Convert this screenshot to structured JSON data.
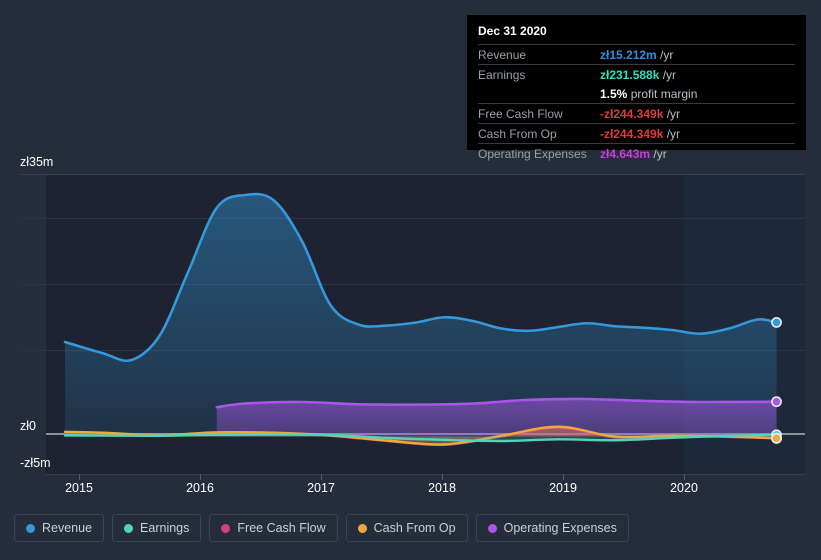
{
  "chart_data": {
    "type": "area",
    "title": "",
    "xlabel": "",
    "ylabel": "",
    "currency_symbol": "zł",
    "grid": true,
    "legend_position": "bottom",
    "ylim": [
      -5,
      35
    ],
    "y_ticks": [
      {
        "value": 35,
        "label": "zł35m"
      },
      {
        "value": 0,
        "label": "zł0"
      },
      {
        "value": -5,
        "label": "-zł5m"
      }
    ],
    "x_ticks": [
      "2015",
      "2016",
      "2017",
      "2018",
      "2019",
      "2020"
    ],
    "x_range": [
      "2014-07",
      "2021-03"
    ],
    "series": [
      {
        "name": "Revenue",
        "color": "#3498db",
        "x": [
          "2014-09",
          "2015-01",
          "2015-04",
          "2015-07",
          "2015-10",
          "2016-01",
          "2016-04",
          "2016-07",
          "2016-10",
          "2017-01",
          "2017-04",
          "2017-07",
          "2017-10",
          "2018-01",
          "2018-04",
          "2018-07",
          "2018-10",
          "2019-01",
          "2019-04",
          "2019-07",
          "2019-10",
          "2020-01",
          "2020-04",
          "2020-07",
          "2020-10",
          "2020-12"
        ],
        "values": [
          12.6,
          11.1,
          10.2,
          13.5,
          22.0,
          30.5,
          32.2,
          31.5,
          26.0,
          17.5,
          14.9,
          14.8,
          15.2,
          15.9,
          15.4,
          14.4,
          14.1,
          14.6,
          15.1,
          14.7,
          14.5,
          14.2,
          13.7,
          14.4,
          15.6,
          15.212
        ]
      },
      {
        "name": "Earnings",
        "color": "#4fd6b8",
        "x": [
          "2014-09",
          "2015-01",
          "2015-07",
          "2016-01",
          "2016-07",
          "2017-01",
          "2017-07",
          "2018-01",
          "2018-07",
          "2019-01",
          "2019-07",
          "2020-01",
          "2020-07",
          "2020-12"
        ],
        "values": [
          0.15,
          0.12,
          0.1,
          0.22,
          0.28,
          0.2,
          -0.2,
          -0.45,
          -0.6,
          -0.38,
          -0.5,
          -0.18,
          0.1,
          0.231588
        ]
      },
      {
        "name": "Free Cash Flow",
        "color": "#d6407f",
        "x": [
          "2014-09",
          "2015-01",
          "2015-07",
          "2016-01",
          "2016-07",
          "2017-01",
          "2017-07",
          "2018-01",
          "2018-07",
          "2019-01",
          "2019-07",
          "2020-01",
          "2020-07",
          "2020-12"
        ],
        "values": [
          0.5,
          0.4,
          0.1,
          0.45,
          0.4,
          0.1,
          -0.6,
          -1.1,
          0.0,
          1.2,
          -0.1,
          0.05,
          -0.05,
          -0.244349
        ]
      },
      {
        "name": "Cash From Op",
        "color": "#f0a83c",
        "x": [
          "2014-09",
          "2015-01",
          "2015-07",
          "2016-01",
          "2016-07",
          "2017-01",
          "2017-07",
          "2018-01",
          "2018-07",
          "2019-01",
          "2019-07",
          "2020-01",
          "2020-07",
          "2020-12"
        ],
        "values": [
          0.62,
          0.5,
          0.18,
          0.55,
          0.5,
          0.15,
          -0.55,
          -1.05,
          0.1,
          1.3,
          0.0,
          0.1,
          0.0,
          -0.244349
        ]
      },
      {
        "name": "Operating Expenses",
        "color": "#a855e8",
        "x": [
          "2016-01",
          "2016-04",
          "2016-10",
          "2017-04",
          "2017-10",
          "2018-04",
          "2018-10",
          "2019-04",
          "2019-10",
          "2020-04",
          "2020-12"
        ],
        "values": [
          3.9,
          4.4,
          4.6,
          4.3,
          4.25,
          4.4,
          4.9,
          5.0,
          4.75,
          4.6,
          4.643
        ]
      }
    ]
  },
  "tooltip": {
    "title": "Dec 31 2020",
    "rows": [
      {
        "key": "Revenue",
        "value": "zł15.212m",
        "unit": " /yr",
        "color": "#2e8fe0"
      },
      {
        "key": "Earnings",
        "value": "zł231.588k",
        "unit": " /yr",
        "color": "#2ee0bd"
      },
      {
        "key": "",
        "value": "1.5%",
        "unit": " profit margin",
        "color": "#ffffff"
      },
      {
        "key": "Free Cash Flow",
        "value": "-zł244.349k",
        "unit": " /yr",
        "color": "#e03c3c"
      },
      {
        "key": "Cash From Op",
        "value": "-zł244.349k",
        "unit": " /yr",
        "color": "#e03c3c"
      },
      {
        "key": "Operating Expenses",
        "value": "zł4.643m",
        "unit": " /yr",
        "color": "#cc3cdd"
      }
    ]
  },
  "legend": {
    "items": [
      {
        "label": "Revenue",
        "color": "#3498db"
      },
      {
        "label": "Earnings",
        "color": "#4fd6b8"
      },
      {
        "label": "Free Cash Flow",
        "color": "#d6407f"
      },
      {
        "label": "Cash From Op",
        "color": "#f0a83c"
      },
      {
        "label": "Operating Expenses",
        "color": "#a855e8"
      }
    ]
  },
  "axis": {
    "y_labels": [
      "zł35m",
      "zł0",
      "-zł5m"
    ],
    "x_labels": [
      "2015",
      "2016",
      "2017",
      "2018",
      "2019",
      "2020"
    ]
  }
}
